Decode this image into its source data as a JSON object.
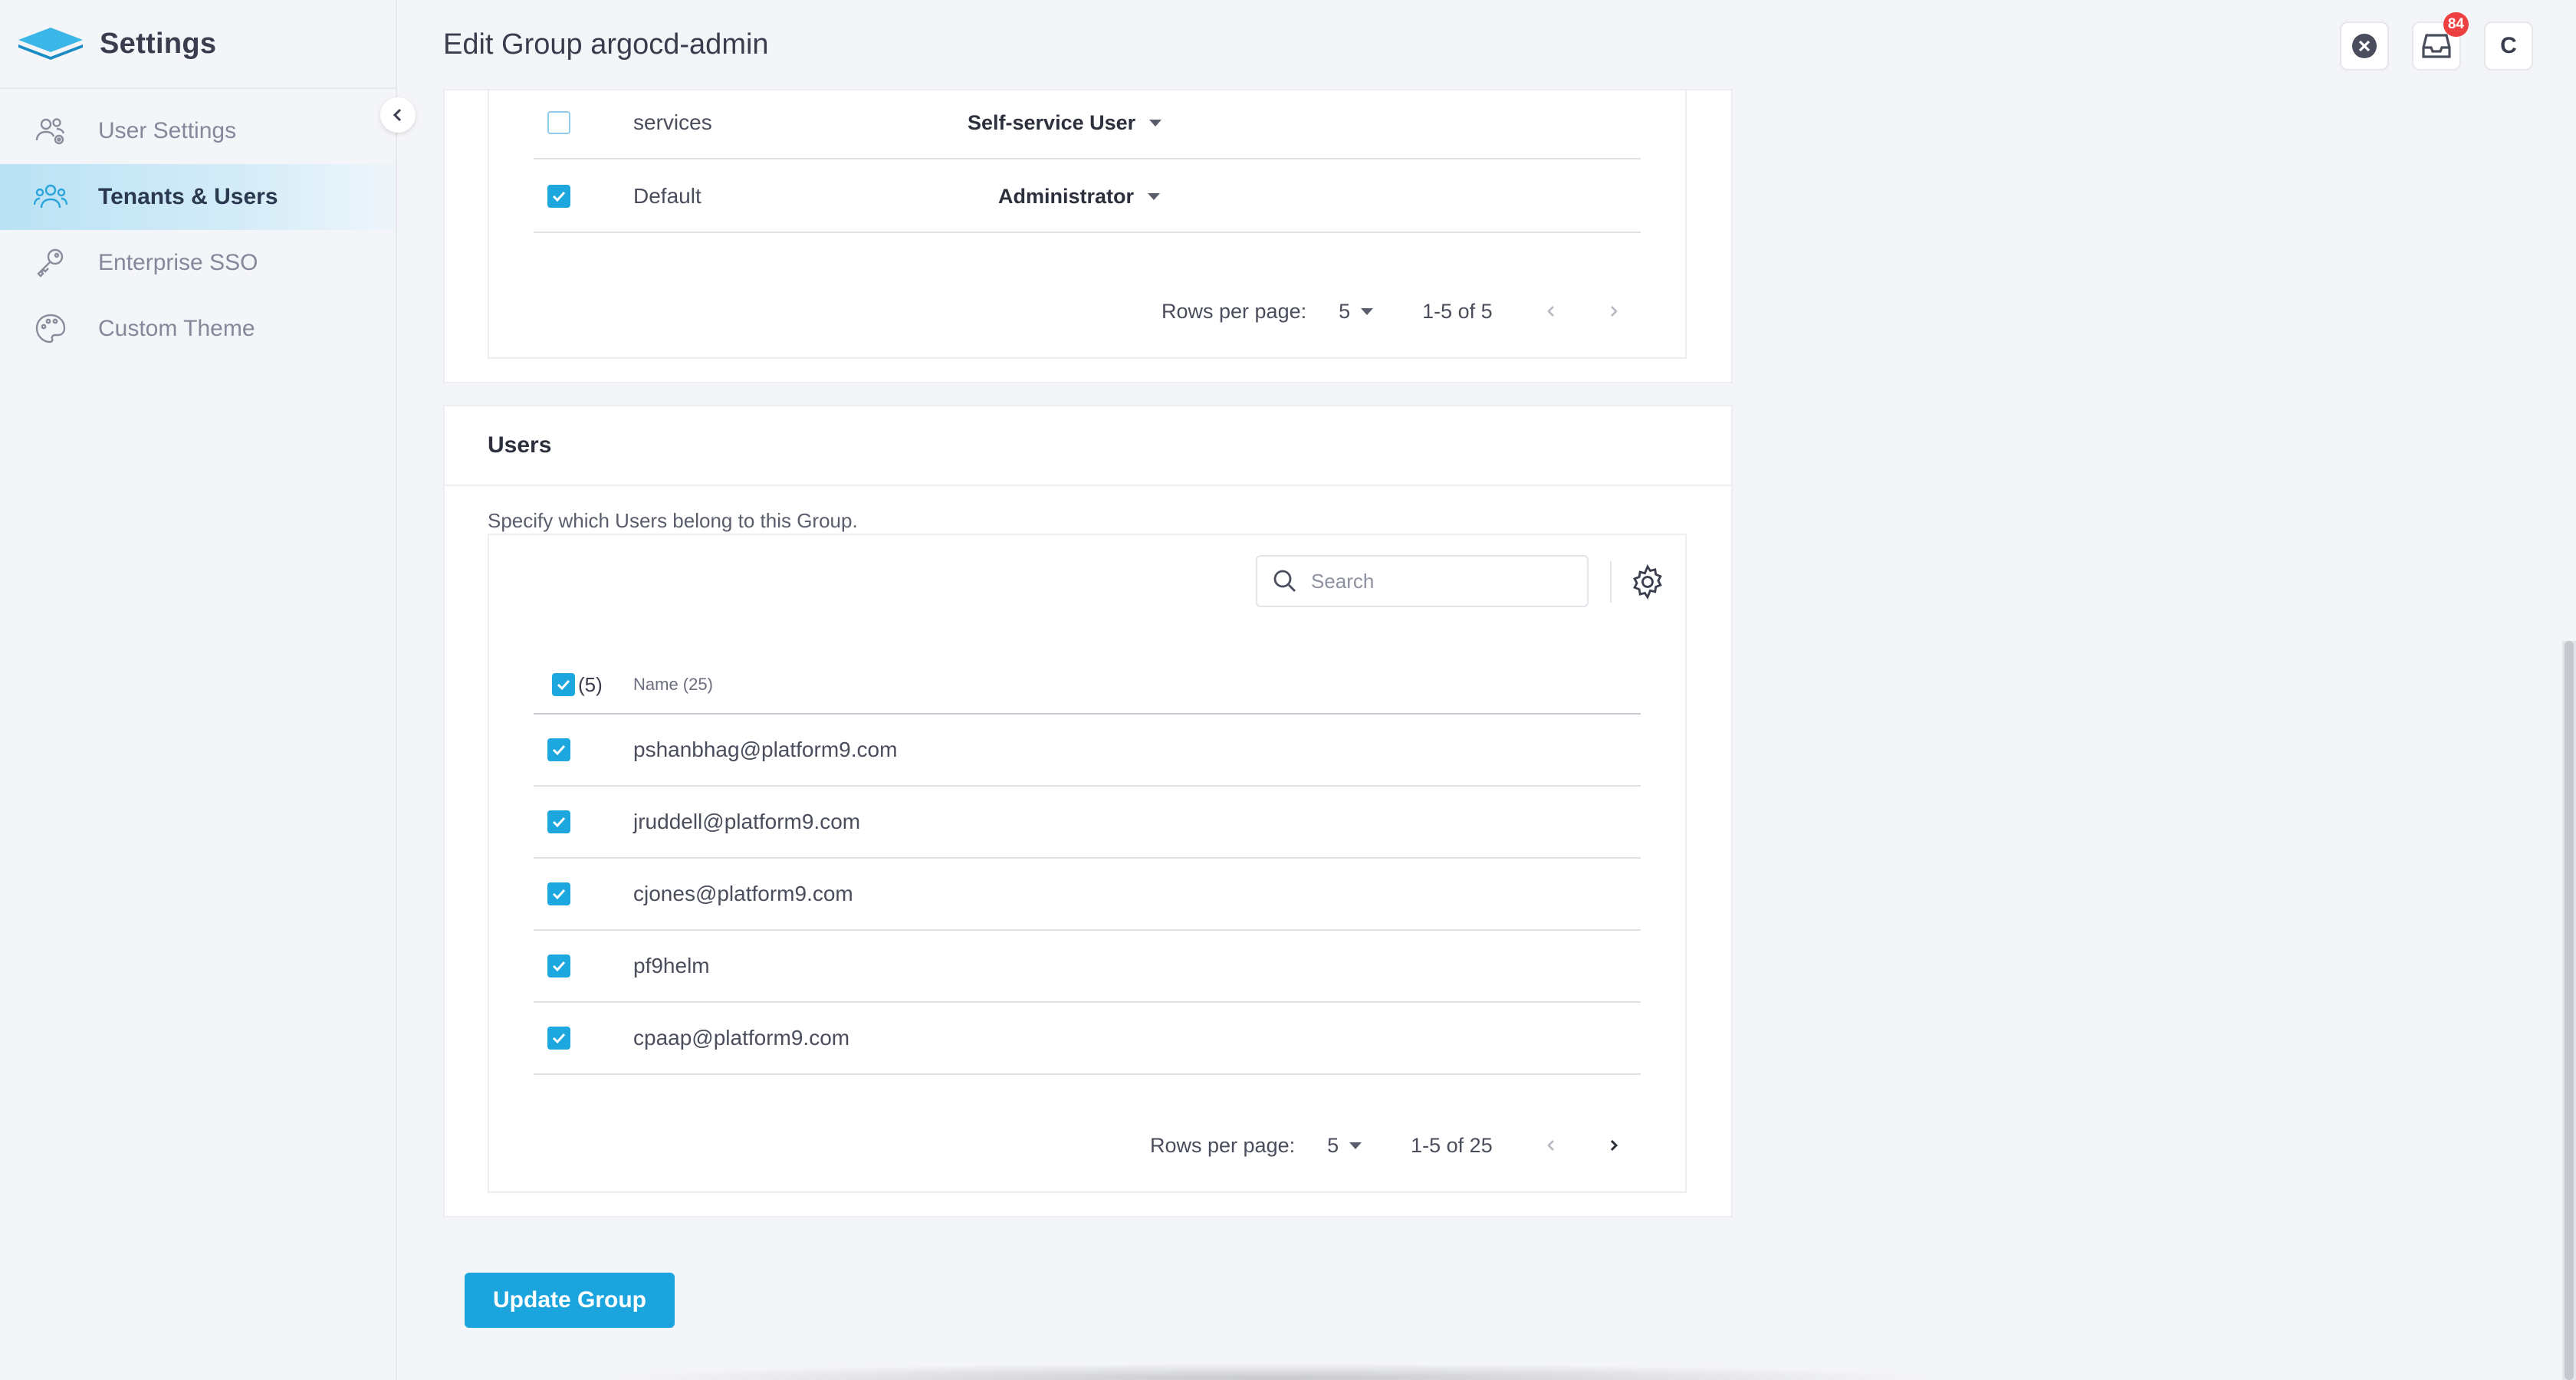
{
  "sidebar": {
    "title": "Settings",
    "items": [
      {
        "label": "User Settings",
        "icon": "users-gear-icon",
        "active": false
      },
      {
        "label": "Tenants & Users",
        "icon": "users-icon",
        "active": true
      },
      {
        "label": "Enterprise SSO",
        "icon": "key-icon",
        "active": false
      },
      {
        "label": "Custom Theme",
        "icon": "palette-icon",
        "active": false
      }
    ]
  },
  "header": {
    "title": "Edit Group argocd-admin",
    "notification_count": "84",
    "avatar_initial": "C"
  },
  "tenants_table": {
    "rows": [
      {
        "name": "services",
        "role": "Self-service User",
        "checked": false
      },
      {
        "name": "Default",
        "role": "Administrator",
        "checked": true
      }
    ],
    "pager": {
      "rows_per_page_label": "Rows per page:",
      "rows_per_page": "5",
      "range": "1-5 of 5"
    }
  },
  "users_section": {
    "title": "Users",
    "description": "Specify which Users belong to this Group.",
    "search_placeholder": "Search",
    "header_selected_count": "(5)",
    "column_name": "Name (25)",
    "rows": [
      {
        "name": "pshanbhag@platform9.com",
        "checked": true
      },
      {
        "name": "jruddell@platform9.com",
        "checked": true
      },
      {
        "name": "cjones@platform9.com",
        "checked": true
      },
      {
        "name": "pf9helm",
        "checked": true
      },
      {
        "name": "cpaap@platform9.com",
        "checked": true
      }
    ],
    "pager": {
      "rows_per_page_label": "Rows per page:",
      "rows_per_page": "5",
      "range": "1-5 of 25"
    }
  },
  "actions": {
    "update_label": "Update Group"
  },
  "colors": {
    "accent": "#1ba4dd",
    "badge": "#ee4040",
    "active_nav": "#b9e2f4"
  }
}
